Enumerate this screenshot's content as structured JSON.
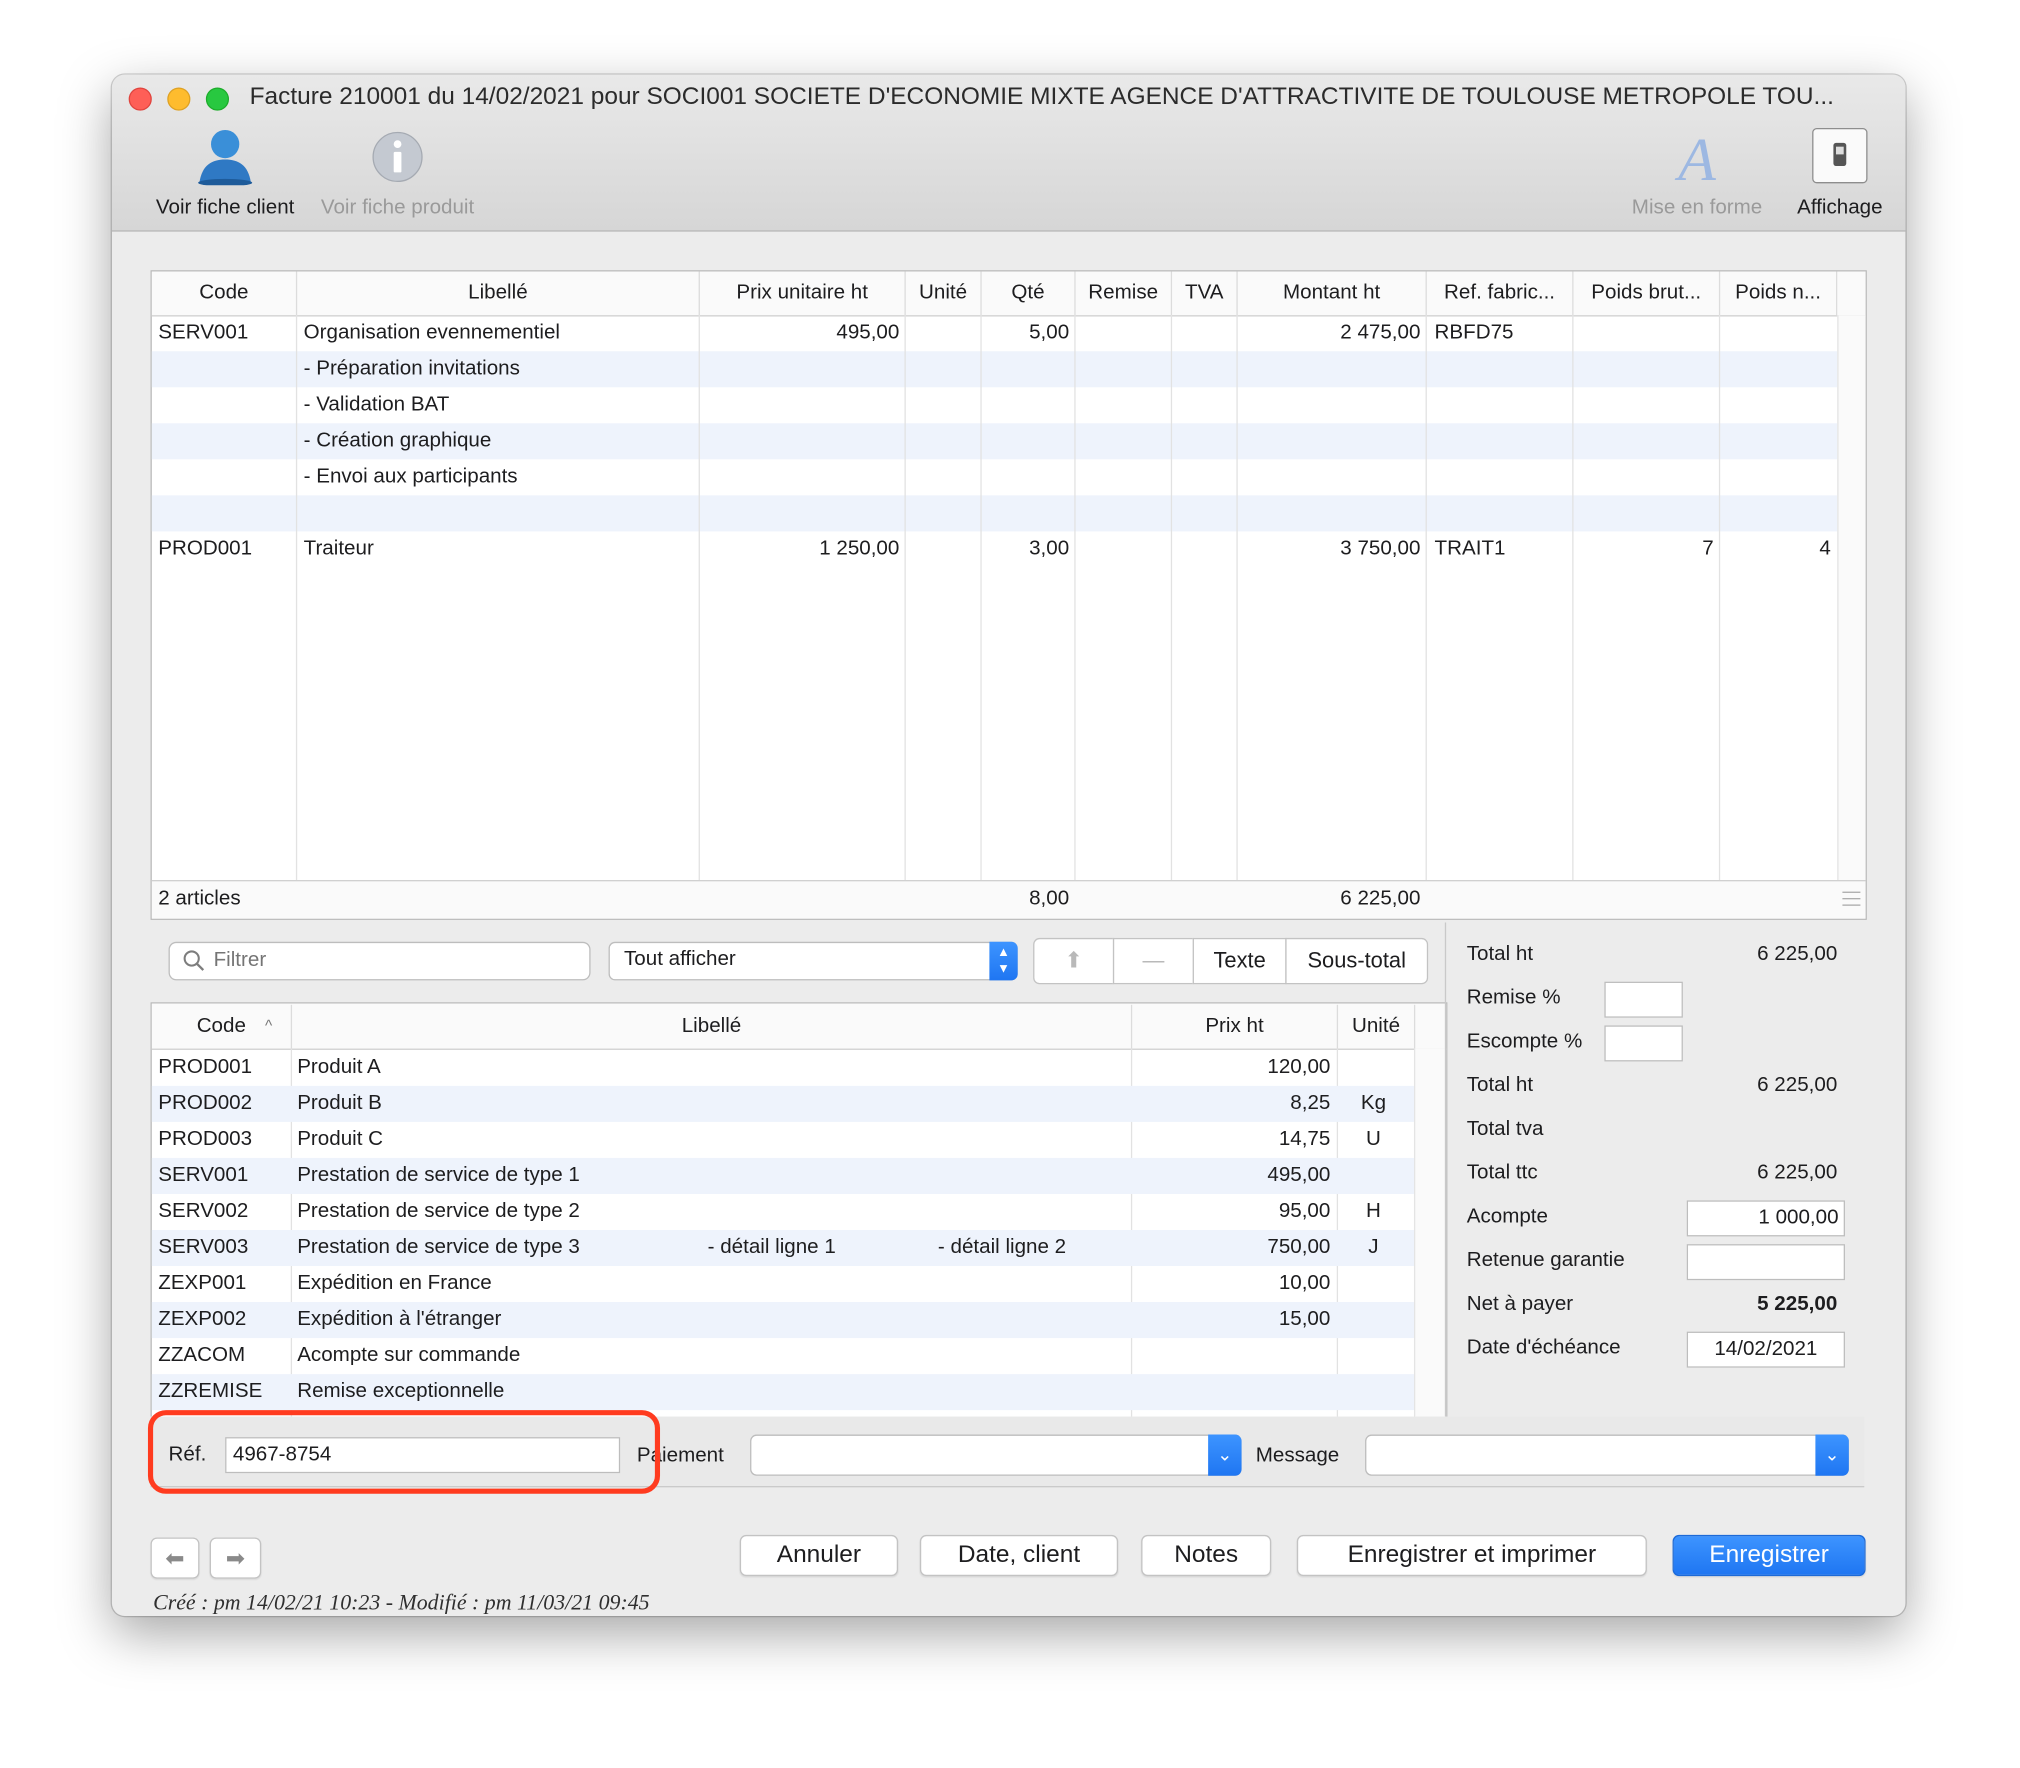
{
  "window": {
    "title": "Facture 210001 du 14/02/2021 pour SOCI001 SOCIETE D'ECONOMIE MIXTE AGENCE D'ATTRACTIVITE DE TOULOUSE METROPOLE TOU..."
  },
  "toolbar": {
    "client": "Voir fiche client",
    "product": "Voir fiche produit",
    "format": "Mise en forme",
    "display": "Affichage"
  },
  "invoice": {
    "columns": [
      "Code",
      "Libellé",
      "Prix unitaire ht",
      "Unité",
      "Qté",
      "Remise",
      "TVA",
      "Montant ht",
      "Ref. fabric...",
      "Poids brut...",
      "Poids n..."
    ],
    "rows": [
      {
        "code": "SERV001",
        "label": "Organisation evennementiel",
        "price": "495,00",
        "unit": "",
        "qty": "5,00",
        "discount": "",
        "tva": "",
        "amount": "2 475,00",
        "ref": "RBFD75",
        "gross": "",
        "net": ""
      },
      {
        "code": "",
        "label": "- Préparation invitations",
        "price": "",
        "unit": "",
        "qty": "",
        "discount": "",
        "tva": "",
        "amount": "",
        "ref": "",
        "gross": "",
        "net": ""
      },
      {
        "code": "",
        "label": "- Validation BAT",
        "price": "",
        "unit": "",
        "qty": "",
        "discount": "",
        "tva": "",
        "amount": "",
        "ref": "",
        "gross": "",
        "net": ""
      },
      {
        "code": "",
        "label": "- Création graphique",
        "price": "",
        "unit": "",
        "qty": "",
        "discount": "",
        "tva": "",
        "amount": "",
        "ref": "",
        "gross": "",
        "net": ""
      },
      {
        "code": "",
        "label": "- Envoi aux participants",
        "price": "",
        "unit": "",
        "qty": "",
        "discount": "",
        "tva": "",
        "amount": "",
        "ref": "",
        "gross": "",
        "net": ""
      },
      {
        "code": "",
        "label": "",
        "price": "",
        "unit": "",
        "qty": "",
        "discount": "",
        "tva": "",
        "amount": "",
        "ref": "",
        "gross": "",
        "net": ""
      },
      {
        "code": "PROD001",
        "label": "Traiteur",
        "price": "1 250,00",
        "unit": "",
        "qty": "3,00",
        "discount": "",
        "tva": "",
        "amount": "3 750,00",
        "ref": "TRAIT1",
        "gross": "7",
        "net": "4"
      }
    ],
    "footer": {
      "count": "2 articles",
      "qty": "8,00",
      "amount": "6 225,00"
    }
  },
  "catalog": {
    "filter_placeholder": "Filtrer",
    "show_select": "Tout afficher",
    "btn_text": "Texte",
    "btn_subtotal": "Sous-total",
    "btn_minus": "—",
    "columns": [
      "Code",
      "Libellé",
      "Prix ht",
      "Unité"
    ],
    "rows": [
      {
        "code": "PROD001",
        "label": "Produit A",
        "d1": "",
        "d2": "",
        "price": "120,00",
        "unit": ""
      },
      {
        "code": "PROD002",
        "label": "Produit B",
        "d1": "",
        "d2": "",
        "price": "8,25",
        "unit": "Kg"
      },
      {
        "code": "PROD003",
        "label": "Produit C",
        "d1": "",
        "d2": "",
        "price": "14,75",
        "unit": "U"
      },
      {
        "code": "SERV001",
        "label": "Prestation de service de type 1",
        "d1": "",
        "d2": "",
        "price": "495,00",
        "unit": ""
      },
      {
        "code": "SERV002",
        "label": "Prestation de service de type 2",
        "d1": "",
        "d2": "",
        "price": "95,00",
        "unit": "H"
      },
      {
        "code": "SERV003",
        "label": "Prestation de service de type 3",
        "d1": "- détail ligne 1",
        "d2": "- détail ligne 2",
        "price": "750,00",
        "unit": "J"
      },
      {
        "code": "ZEXP001",
        "label": "Expédition en France",
        "d1": "",
        "d2": "",
        "price": "10,00",
        "unit": ""
      },
      {
        "code": "ZEXP002",
        "label": "Expédition à l'étranger",
        "d1": "",
        "d2": "",
        "price": "15,00",
        "unit": ""
      },
      {
        "code": "ZZACOM",
        "label": "Acompte sur commande",
        "d1": "",
        "d2": "",
        "price": "",
        "unit": ""
      },
      {
        "code": "ZZREMISE",
        "label": "Remise exceptionnelle",
        "d1": "",
        "d2": "",
        "price": "",
        "unit": ""
      }
    ]
  },
  "summary": {
    "total_ht_label": "Total ht",
    "total_ht": "6 225,00",
    "remise_label": "Remise %",
    "remise": "",
    "escompte_label": "Escompte %",
    "escompte": "",
    "total_ht2_label": "Total ht",
    "total_ht2": "6 225,00",
    "tva_label": "Total tva",
    "tva": "",
    "ttc_label": "Total ttc",
    "ttc": "6 225,00",
    "acompte_label": "Acompte",
    "acompte": "1 000,00",
    "retenue_label": "Retenue garantie",
    "retenue": "",
    "net_label": "Net à payer",
    "net": "5 225,00",
    "date_label": "Date d'échéance",
    "date": "14/02/2021"
  },
  "bottom": {
    "ref_label": "Réf.",
    "ref_value": "4967-8754",
    "payment_label": "Paiement",
    "payment_value": "",
    "message_label": "Message",
    "message_value": ""
  },
  "actions": {
    "cancel": "Annuler",
    "date_client": "Date, client",
    "notes": "Notes",
    "save_print": "Enregistrer et imprimer",
    "save": "Enregistrer"
  },
  "status": "Créé : pm 14/02/21 10:23 - Modifié : pm 11/03/21 09:45",
  "colors": {
    "highlight": "#ff3b1f",
    "accent": "#1f76f2",
    "row_alt": "#eef3fc"
  }
}
